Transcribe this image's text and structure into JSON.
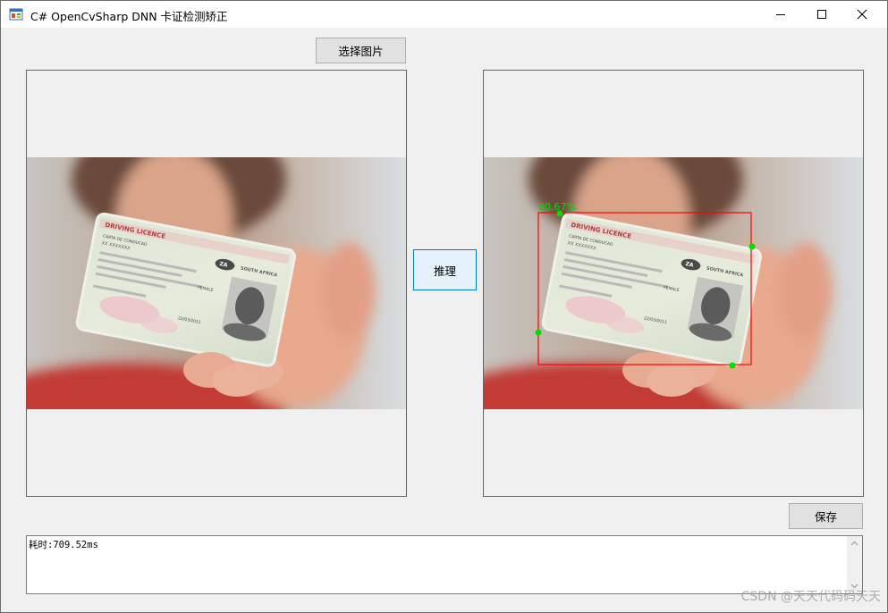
{
  "window": {
    "title": "C# OpenCvSharp DNN 卡证检测矫正"
  },
  "controls": {
    "select_image_label": "选择图片",
    "infer_label": "推理",
    "save_label": "保存"
  },
  "result": {
    "score_label": "80.67%"
  },
  "card": {
    "header": "DRIVING LICENCE",
    "sub": "CARTA DE CONDUCAO",
    "name": "XX XXXXXXX",
    "country": "SOUTH AFRICA",
    "code": "ZA",
    "sex": "FEMALE",
    "date": "22/03/2011"
  },
  "log": {
    "text": "耗时:709.52ms"
  },
  "watermark": "CSDN @天天代码码天天",
  "colors": {
    "accent": "#0078d7",
    "bbox": "#ff0000",
    "keypoint": "#00dd00"
  }
}
